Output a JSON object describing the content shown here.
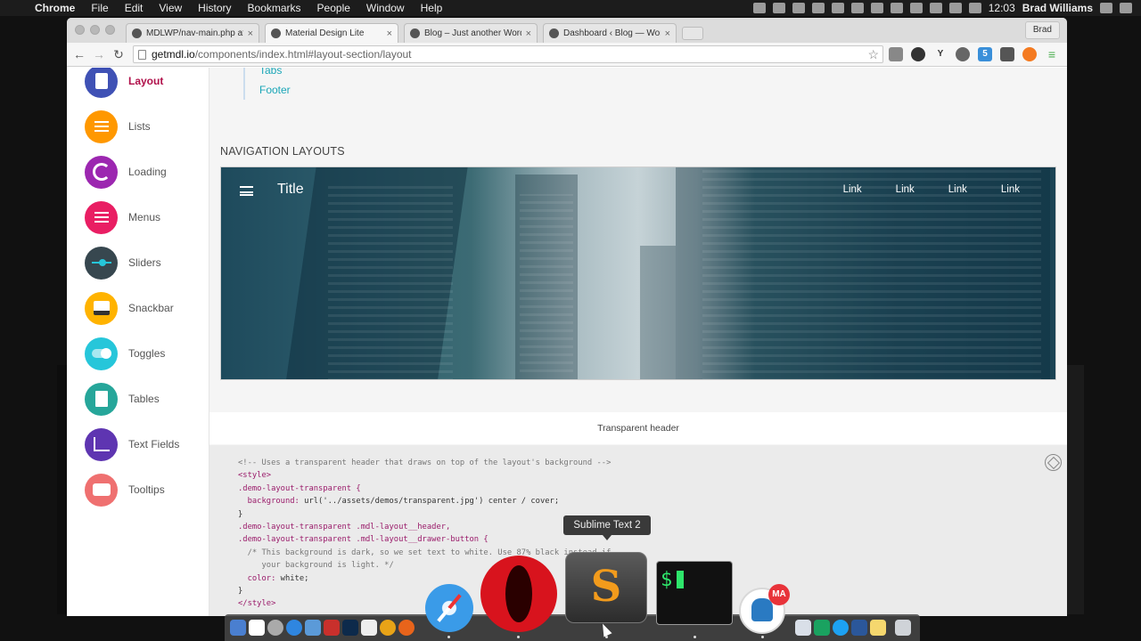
{
  "menubar": {
    "app": "Chrome",
    "items": [
      "File",
      "Edit",
      "View",
      "History",
      "Bookmarks",
      "People",
      "Window",
      "Help"
    ],
    "clock": "12:03",
    "user": "Brad Williams"
  },
  "browser": {
    "tabs": [
      {
        "label": "MDLWP/nav-main.php at m"
      },
      {
        "label": "Material Design Lite"
      },
      {
        "label": "Blog – Just another WordP"
      },
      {
        "label": "Dashboard ‹ Blog — WordP"
      }
    ],
    "profile": "Brad",
    "url_host": "getmdl.io",
    "url_path": "/components/index.html#layout-section/layout"
  },
  "sidebar": {
    "items": [
      {
        "label": "Layout",
        "color": "#3f51b5",
        "active": true
      },
      {
        "label": "Lists",
        "color": "#ff9800"
      },
      {
        "label": "Loading",
        "color": "#9c27b0"
      },
      {
        "label": "Menus",
        "color": "#e91e63"
      },
      {
        "label": "Sliders",
        "color": "#37474f"
      },
      {
        "label": "Snackbar",
        "color": "#ffb300"
      },
      {
        "label": "Toggles",
        "color": "#26c6da"
      },
      {
        "label": "Tables",
        "color": "#26a69a"
      },
      {
        "label": "Text Fields",
        "color": "#5e35b1"
      },
      {
        "label": "Tooltips",
        "color": "#ef7070"
      }
    ]
  },
  "toc": {
    "items": [
      "Tabs",
      "Footer"
    ]
  },
  "main": {
    "section_title": "NAVIGATION LAYOUTS",
    "demo": {
      "title": "Title",
      "links": [
        "Link",
        "Link",
        "Link",
        "Link"
      ]
    },
    "caption": "Transparent header",
    "code": {
      "l1": "<!-- Uses a transparent header that draws on top of the layout's background -->",
      "l2": "<style>",
      "l3": ".demo-layout-transparent {",
      "l4a": "  background: ",
      "l4b": "url('../assets/demos/transparent.jpg') center / cover;",
      "l5": "}",
      "l6": ".demo-layout-transparent .mdl-layout__header,",
      "l7": ".demo-layout-transparent .mdl-layout__drawer-button {",
      "l8": "  /* This background is dark, so we set text to white. Use 87% black instead if",
      "l9": "     your background is light. */",
      "l10a": "  color: ",
      "l10b": "white;",
      "l11": "}",
      "l12": "</style>"
    }
  },
  "dock": {
    "tooltip": "Sublime Text 2",
    "terminal_prompt": "$",
    "mamp_badge": "MA"
  }
}
